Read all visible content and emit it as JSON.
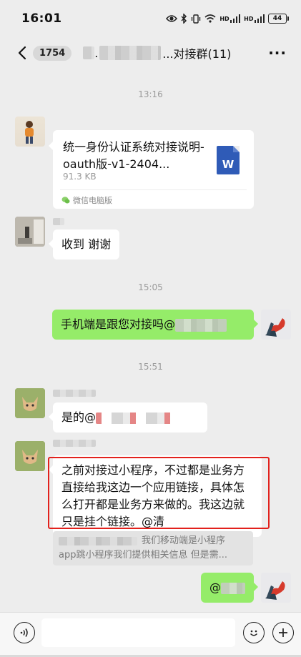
{
  "status_bar": {
    "time": "16:01",
    "battery": "44",
    "icons": [
      "eye-icon",
      "bluetooth-icon",
      "vibrate-icon",
      "wifi-icon",
      "signal-icon",
      "signal-icon",
      "battery-icon"
    ]
  },
  "nav": {
    "unread_count": "1754",
    "title_prefix": ".",
    "title_suffix": "...对接群(11)",
    "more_label": "···"
  },
  "messages": {
    "time_1": "13:16",
    "file": {
      "name": "统一身份认证系统对接说明-oauth版-v1-2404...",
      "size": "91.3 KB",
      "source": "微信电脑版",
      "icon_letter": "W"
    },
    "msg_2": "收到 谢谢",
    "time_2": "15:05",
    "msg_3_prefix": "手机端是跟您对接吗@",
    "time_3": "15:51",
    "msg_4_prefix": "是的@",
    "msg_5": "之前对接过小程序，不过都是业务方直接给我这边一个应用链接，具体怎么打开都是业务方来做的。我这边就只是挂个链接。@清",
    "quote_line_1": "我们移动端是小程序",
    "quote_line_2": "app跳小程序我们提供相关信息 但是需...",
    "msg_6_prefix": "@"
  },
  "input_bar": {
    "placeholder": ""
  },
  "colors": {
    "background": "#ededed",
    "self_bubble": "#95ec69",
    "other_bubble": "#ffffff",
    "highlight_border": "#e2211c",
    "word_icon": "#2f5bb7"
  }
}
